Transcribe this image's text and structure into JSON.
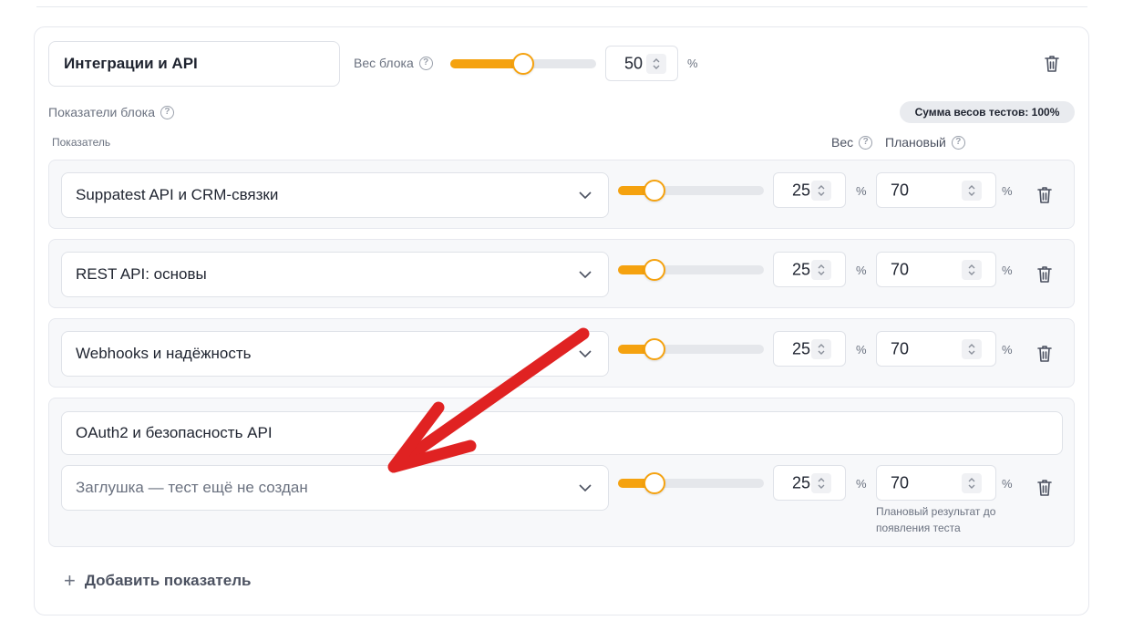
{
  "block": {
    "name": "Интеграции и API",
    "weight_label": "Вес блока",
    "weight_value": "50",
    "weight_fraction": 0.5,
    "percent_sign": "%"
  },
  "indicators": {
    "section_label": "Показатели блока",
    "weights_sum_badge": "Сумма весов тестов: 100%",
    "col_indicator": "Показатель",
    "col_weight": "Вес",
    "col_planned": "Плановый"
  },
  "rows": [
    {
      "test": "Suppatest API и CRM-связки",
      "weight": "25",
      "weight_fraction": 0.25,
      "planned": "70"
    },
    {
      "test": "REST API: основы",
      "weight": "25",
      "weight_fraction": 0.25,
      "planned": "70"
    },
    {
      "test": "Webhooks и надёжность",
      "weight": "25",
      "weight_fraction": 0.25,
      "planned": "70"
    }
  ],
  "placeholder_row": {
    "name": "OAuth2 и безопасность API",
    "test_placeholder": "Заглушка — тест ещё не создан",
    "weight": "25",
    "weight_fraction": 0.25,
    "planned": "70",
    "hint": "Плановый результат до появления теста"
  },
  "add_indicator_label": "Добавить показатель",
  "icons": {
    "help": "question-circle-icon",
    "trash": "trash-icon",
    "chevron": "chevron-down-icon",
    "stepper": "stepper-icon",
    "plus": "plus-icon"
  },
  "colors": {
    "accent": "#f5a20f",
    "annotation_arrow": "#e02222"
  }
}
